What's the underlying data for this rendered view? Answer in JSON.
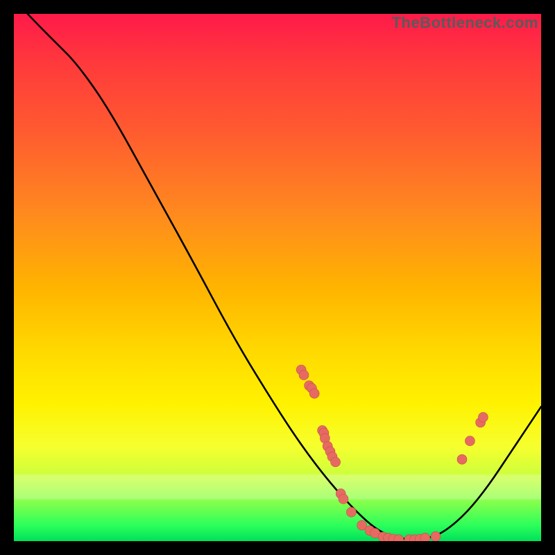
{
  "source_label": "TheBottleneck.com",
  "colors": {
    "curve_stroke": "#000000",
    "marker_fill": "#e76a62",
    "marker_stroke": "#c05048"
  },
  "chart_data": {
    "type": "line",
    "title": "",
    "xlabel": "",
    "ylabel": "",
    "xlim": [
      0,
      100
    ],
    "ylim": [
      0,
      100
    ],
    "curve": [
      {
        "x": 2.6,
        "y": 100.0
      },
      {
        "x": 5.0,
        "y": 97.5
      },
      {
        "x": 8.0,
        "y": 94.5
      },
      {
        "x": 12.0,
        "y": 90.5
      },
      {
        "x": 18.0,
        "y": 82.0
      },
      {
        "x": 26.0,
        "y": 67.5
      },
      {
        "x": 34.0,
        "y": 53.0
      },
      {
        "x": 42.0,
        "y": 38.0
      },
      {
        "x": 50.0,
        "y": 25.0
      },
      {
        "x": 55.0,
        "y": 17.5
      },
      {
        "x": 60.0,
        "y": 11.0
      },
      {
        "x": 65.0,
        "y": 5.5
      },
      {
        "x": 69.0,
        "y": 2.0
      },
      {
        "x": 72.5,
        "y": 0.6
      },
      {
        "x": 76.0,
        "y": 0.3
      },
      {
        "x": 79.0,
        "y": 0.6
      },
      {
        "x": 82.0,
        "y": 2.0
      },
      {
        "x": 86.0,
        "y": 5.5
      },
      {
        "x": 90.0,
        "y": 10.5
      },
      {
        "x": 94.0,
        "y": 16.5
      },
      {
        "x": 97.0,
        "y": 21.0
      },
      {
        "x": 100.0,
        "y": 25.5
      }
    ],
    "markers": [
      {
        "x": 54.5,
        "y": 32.5
      },
      {
        "x": 55.0,
        "y": 31.5
      },
      {
        "x": 56.0,
        "y": 29.5
      },
      {
        "x": 56.5,
        "y": 29.0
      },
      {
        "x": 57.0,
        "y": 28.0
      },
      {
        "x": 58.5,
        "y": 21.0
      },
      {
        "x": 58.8,
        "y": 20.5
      },
      {
        "x": 59.0,
        "y": 19.5
      },
      {
        "x": 59.5,
        "y": 18.0
      },
      {
        "x": 60.0,
        "y": 17.0
      },
      {
        "x": 60.4,
        "y": 16.0
      },
      {
        "x": 61.0,
        "y": 15.0
      },
      {
        "x": 62.0,
        "y": 9.0
      },
      {
        "x": 62.5,
        "y": 8.0
      },
      {
        "x": 64.0,
        "y": 5.5
      },
      {
        "x": 66.0,
        "y": 3.0
      },
      {
        "x": 67.5,
        "y": 2.0
      },
      {
        "x": 68.5,
        "y": 1.5
      },
      {
        "x": 70.0,
        "y": 0.8
      },
      {
        "x": 71.0,
        "y": 0.6
      },
      {
        "x": 72.0,
        "y": 0.4
      },
      {
        "x": 73.0,
        "y": 0.3
      },
      {
        "x": 75.0,
        "y": 0.3
      },
      {
        "x": 76.0,
        "y": 0.3
      },
      {
        "x": 77.0,
        "y": 0.4
      },
      {
        "x": 78.0,
        "y": 0.6
      },
      {
        "x": 80.0,
        "y": 0.9
      },
      {
        "x": 85.0,
        "y": 15.5
      },
      {
        "x": 86.5,
        "y": 19.0
      },
      {
        "x": 88.5,
        "y": 22.5
      },
      {
        "x": 89.0,
        "y": 23.5
      }
    ]
  }
}
